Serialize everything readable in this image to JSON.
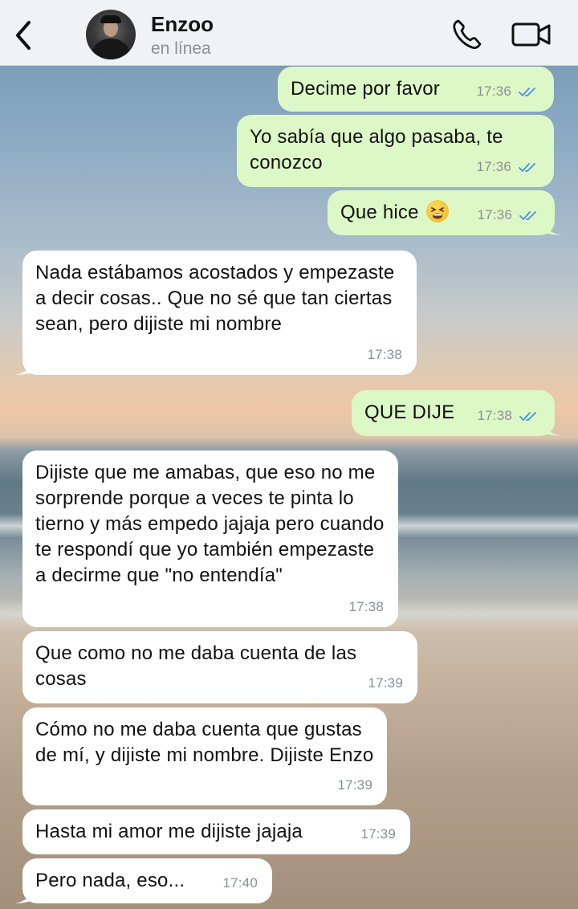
{
  "header": {
    "back_icon": "chevron-left-icon",
    "contact_name": "Enzoo",
    "contact_status": "en línea",
    "call_icon": "phone-icon",
    "video_icon": "video-camera-icon"
  },
  "colors": {
    "outgoing_bubble": "#dcf8c6",
    "incoming_bubble": "#ffffff",
    "read_ticks": "#4a90e2",
    "timestamp": "#8a8f94"
  },
  "messages": [
    {
      "direction": "outgoing",
      "text": "Decime por favor",
      "time": "17:36",
      "status": "read"
    },
    {
      "direction": "outgoing",
      "text": "Yo sabía que algo pasaba, te conozco",
      "time": "17:36",
      "status": "read"
    },
    {
      "direction": "outgoing",
      "text": "Que hice",
      "emoji": "tired-face-emoji",
      "time": "17:36",
      "status": "read"
    },
    {
      "direction": "incoming",
      "text": "Nada estábamos acostados y empezaste a decir cosas.. Que no sé que tan ciertas sean, pero dijiste mi nombre",
      "time": "17:38"
    },
    {
      "direction": "outgoing",
      "text": "QUE DIJE",
      "time": "17:38",
      "status": "read"
    },
    {
      "direction": "incoming",
      "text": "Dijiste que me amabas, que eso no me sorprende porque a veces te pinta lo tierno y más empedo jajaja pero cuando te respondí que yo también empezaste a decirme que \"no entendía\"",
      "time": "17:38"
    },
    {
      "direction": "incoming",
      "text": "Que como no me daba cuenta de las cosas",
      "time": "17:39"
    },
    {
      "direction": "incoming",
      "text": "Cómo no me daba cuenta que gustas de mí, y dijiste mi nombre. Dijiste Enzo",
      "time": "17:39"
    },
    {
      "direction": "incoming",
      "text": "Hasta mi amor me dijiste jajaja",
      "time": "17:39"
    },
    {
      "direction": "incoming",
      "text": "Pero nada, eso...",
      "time": "17:40"
    }
  ]
}
